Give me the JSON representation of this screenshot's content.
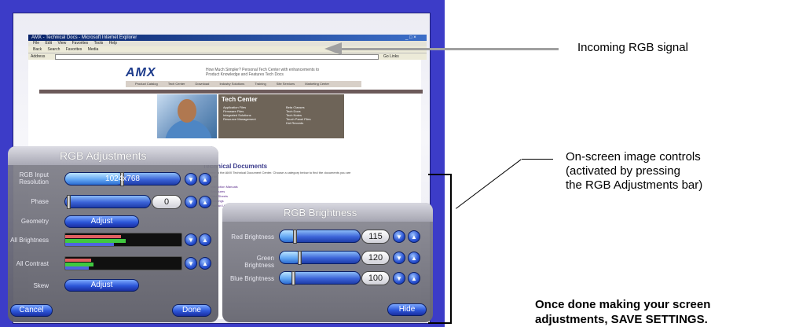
{
  "browser": {
    "title": "AMX - Technical Docs - Microsoft Internet Explorer",
    "window_buttons": "_ □ ×",
    "menu": [
      "File",
      "Edit",
      "View",
      "Favorites",
      "Tools",
      "Help"
    ],
    "toolbar": [
      "Back",
      "Search",
      "Favorites",
      "Media"
    ],
    "address_label": "Address",
    "go_label": "Go",
    "links_label": "Links"
  },
  "amx_page": {
    "logo": "AMX",
    "header_text": "How Much Simpler? Personal Tech Center with enhancements to Product Knowledge and Features Tech Docs",
    "nav": [
      "Product Catalog",
      "Tech Center",
      "Download",
      "Industry Solutions",
      "Training",
      "Site Services",
      "Marketing Center"
    ],
    "tech_center_title": "Tech Center",
    "tech_center_col1": [
      "Application Files",
      "Firmware Files",
      "Integrated Solutions",
      "Resource Management"
    ],
    "tech_center_col2": [
      "Beta Classes",
      "Tech Docs",
      "Tech Notes",
      "Touch Panel Files",
      "Hot Records"
    ],
    "doc_title": "Technical Documents",
    "doc_text": "Welcome to the AMX Technical Document Center. Choose a category below to find the documents you are looking for.",
    "doc_links": [
      "Instruction Manuals",
      "Brochures",
      "Data Sheets",
      "Drawings",
      "Product Updates"
    ]
  },
  "rgb_adjustments": {
    "title": "RGB Adjustments",
    "rows": {
      "resolution": {
        "label": "RGB Input Resolution",
        "value": "1024x768",
        "level": 0.5
      },
      "phase": {
        "label": "Phase",
        "value": "0",
        "level": 0.0
      },
      "geometry": {
        "label": "Geometry",
        "button": "Adjust"
      },
      "brightness": {
        "label": "All Brightness",
        "red": 0.48,
        "green": 0.52,
        "blue": 0.42
      },
      "contrast": {
        "label": "All Contrast",
        "red": 0.22,
        "green": 0.24,
        "blue": 0.2
      },
      "skew": {
        "label": "Skew",
        "button": "Adjust"
      }
    },
    "cancel_label": "Cancel",
    "done_label": "Done",
    "down_glyph": "▼",
    "up_glyph": "▲"
  },
  "rgb_brightness": {
    "title": "RGB Brightness",
    "rows": [
      {
        "label": "Red Brightness",
        "value": "115",
        "level": 0.2
      },
      {
        "label": "Green Brightness",
        "value": "120",
        "level": 0.25
      },
      {
        "label": "Blue Brightness",
        "value": "100",
        "level": 0.18
      }
    ],
    "hide_label": "Hide"
  },
  "callouts": {
    "incoming": "Incoming RGB signal",
    "onscreen_1": "On-screen image controls",
    "onscreen_2": "(activated by pressing",
    "onscreen_3": "the RGB Adjustments bar)",
    "done_1": "Once done making your screen",
    "done_2": "adjustments, SAVE SETTINGS."
  },
  "colors": {
    "screen_border": "#3c3cc8",
    "button_blue": "#2c56d8",
    "panel_gray": "#82828c"
  }
}
